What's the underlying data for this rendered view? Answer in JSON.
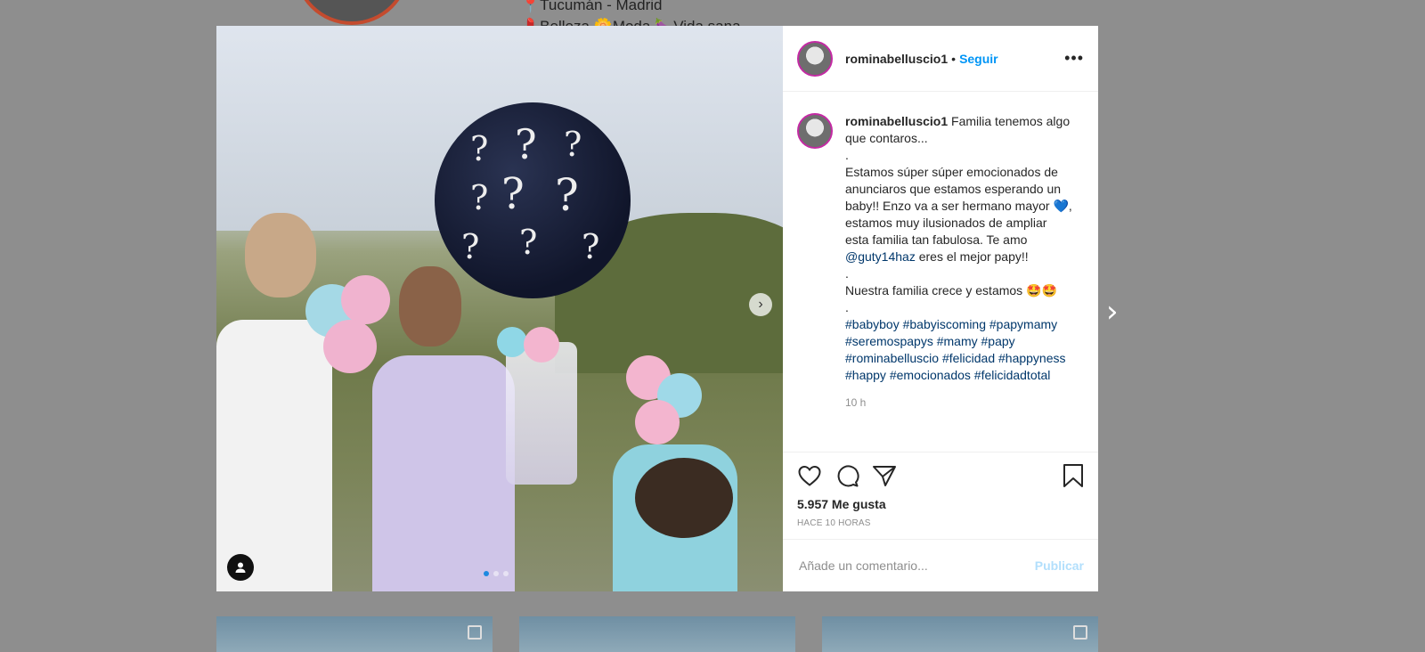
{
  "background": {
    "bio_location": "Tucumán - Madrid",
    "bio_interests": "Belleza 🌼Moda 🍆Vida sana"
  },
  "post": {
    "author": "rominabelluscio1",
    "separator": "•",
    "follow_label": "Seguir",
    "caption_lines": [
      "Familia tenemos algo que contaros...",
      ".",
      "Estamos súper súper emocionados de anunciaros que estamos esperando un baby!! Enzo va a ser hermano mayor 💙, estamos muy ilusionados de ampliar esta familia tan fabulosa. Te amo",
      "@guty14haz",
      "eres el mejor papy!!",
      ".",
      "Nuestra familia crece y estamos 🤩🤩",
      "."
    ],
    "hashtags": [
      "#babyboy",
      "#babyiscoming",
      "#papymamy",
      "#seremospapys",
      "#mamy",
      "#papy",
      "#rominabelluscio",
      "#felicidad",
      "#happyness",
      "#happy",
      "#emocionados",
      "#felicidadtotal"
    ],
    "caption_time": "10 h",
    "likes": "5.957 Me gusta",
    "posted_ago": "HACE 10 HORAS",
    "comment_placeholder": "Añade un comentario...",
    "publish_label": "Publicar",
    "media_dots": 3,
    "media_active_dot": 0
  },
  "icons": {
    "like": "heart-icon",
    "comment": "comment-icon",
    "share": "share-icon",
    "save": "bookmark-icon",
    "more": "more-options-icon",
    "media_next": "chevron-right-icon",
    "modal_next": "chevron-right-icon",
    "user_tag": "user-icon"
  },
  "colors": {
    "link": "#0095f6",
    "hashtag": "#00376b",
    "muted": "#8e8e8e",
    "publish_disabled": "#b2dffc"
  }
}
